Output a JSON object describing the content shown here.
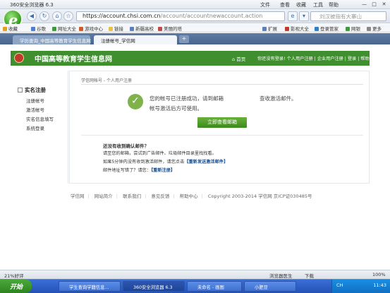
{
  "browser": {
    "title": "360安全浏览器 6.3",
    "menu": [
      "文件",
      "查看",
      "收藏",
      "工具",
      "帮助"
    ],
    "window_controls": [
      "—",
      "□",
      "✕"
    ],
    "url_host": "https://account.chsi.com.cn",
    "url_path": "/account/accountnewaccount.action",
    "search_placeholder": "刘汉被指有大寨山",
    "colors": {
      "accent_green": "#3f8f2f",
      "tab_bar": "#4a668f"
    }
  },
  "favorites": {
    "left": [
      {
        "label": "收藏",
        "icon": "star-icon",
        "color": "#e6a020"
      },
      {
        "label": "谷歌",
        "icon": "google-icon",
        "color": "#4c7bd8"
      },
      {
        "label": "网址大全",
        "icon": "globe-icon",
        "color": "#3b9b3b"
      },
      {
        "label": "游戏中心",
        "icon": "game-icon",
        "color": "#d05a2a"
      },
      {
        "label": "链接",
        "icon": "folder-icon",
        "color": "#e8c04a"
      },
      {
        "label": "新疆高校",
        "icon": "page-icon",
        "color": "#5a7fc0"
      },
      {
        "label": "美丽的塔",
        "icon": "page-icon",
        "color": "#c04a4a"
      }
    ],
    "right": [
      {
        "label": "扩展",
        "icon": "grid-icon",
        "color": "#5a7fc0"
      },
      {
        "label": "影视大全",
        "icon": "film-icon",
        "color": "#c0392b"
      },
      {
        "label": "登录管家",
        "icon": "key-icon",
        "color": "#2a7fd0"
      },
      {
        "label": "网银",
        "icon": "bank-icon",
        "color": "#3b9b3b"
      },
      {
        "label": "更多",
        "icon": "more-icon",
        "color": "#888888"
      }
    ]
  },
  "tabs": [
    {
      "label": "学历查询_中国高等教育学生信息网"
    },
    {
      "label": "注册帐号_学信网"
    }
  ],
  "site": {
    "name": "中国高等教育学生信息网",
    "home": "首页",
    "links": "你还没有登录! 个人用户注册 | 企业用户注册 | 登录 | 帮助"
  },
  "sidebar": {
    "heading": "实名注册",
    "items": [
      "注册帐号",
      "激活帐号",
      "实名信息填写",
      "系统登录"
    ]
  },
  "content": {
    "breadcrumb": "学信网帐号 - 个人用户注册",
    "msg_line1": "您的帐号已注册成功，请到邮箱",
    "msg_line1b": "查收激活邮件。",
    "msg_line2": "帐号激活后方可使用。",
    "button": "立即查看邮箱",
    "faq_title": "还没有收到确认邮件？",
    "faq1": "请至您的邮箱，尝试到广告邮件、垃圾邮件目录里找找看。",
    "faq2_pre": "如果5分钟内没有收到激活邮件，请您点击",
    "faq2_link": "【重新发送激活邮件】",
    "faq3_pre": "邮件地址写错了？请您：",
    "faq3_link": "【重新注册】"
  },
  "footer": {
    "links": [
      "学信网",
      "网站简介",
      "联系我们",
      "意见反馈",
      "帮助中心"
    ],
    "copyright": "Copyright 2003-2014 学信网 京ICP证030485号"
  },
  "statusbar": {
    "left": "21%好评",
    "right_items": [
      "浏览器医生",
      "下载",
      "100%"
    ]
  },
  "taskbar": {
    "start": "开始",
    "items": [
      "学生查询学籍信息...",
      "360安全浏览器 6.3",
      "未命名 - 画图",
      "小肥豆"
    ],
    "lang": "CH",
    "time": "11:43"
  }
}
